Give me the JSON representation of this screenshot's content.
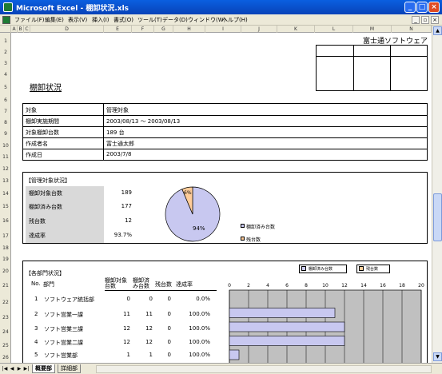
{
  "window": {
    "title": "Microsoft Excel - 棚卸状況.xls"
  },
  "menu": [
    "ファイル(F)",
    "編集(E)",
    "表示(V)",
    "挿入(I)",
    "書式(O)",
    "ツール(T)",
    "データ(D)",
    "ウィンドウ(W)",
    "ヘルプ(H)"
  ],
  "columns": [
    "A",
    "B",
    "C",
    "D",
    "E",
    "F",
    "G",
    "H",
    "I",
    "J",
    "K",
    "L",
    "M",
    "N"
  ],
  "rows": [
    "1",
    "2",
    "3",
    "4",
    "5",
    "6",
    "7",
    "8",
    "9",
    "10",
    "11",
    "12",
    "13",
    "14",
    "15",
    "16",
    "17",
    "18",
    "19",
    "20",
    "21",
    "22",
    "23",
    "24",
    "25",
    "26"
  ],
  "company": "富士通ソフトウェア",
  "heading": "棚卸状況",
  "info": [
    {
      "label": "対象",
      "value": "管理対象"
    },
    {
      "label": "棚卸実施期間",
      "value": "2003/08/13 〜 2003/08/13"
    },
    {
      "label": "対象棚卸台数",
      "value": "189 台"
    },
    {
      "label": "作成者名",
      "value": "富士通太郎"
    },
    {
      "label": "作成日",
      "value": "2003/7/8"
    }
  ],
  "managed": {
    "title": "【管理対象状況】",
    "rows": [
      {
        "label": "棚卸対象台数",
        "value": "189"
      },
      {
        "label": "棚卸済み台数",
        "value": "177"
      },
      {
        "label": "残台数",
        "value": "12"
      },
      {
        "label": "達成率",
        "value": "93.7%"
      }
    ],
    "pie": {
      "done_label": "94%",
      "remain_label": "6%",
      "legend": [
        "棚卸済み台数",
        "残台数"
      ]
    }
  },
  "dept": {
    "title": "【各部門状況】",
    "headers": [
      "No.",
      "部門",
      "棚卸対象台数",
      "棚卸済み台数",
      "残台数",
      "達成率"
    ],
    "rows": [
      {
        "no": "1",
        "name": "ソフトウェア統括部",
        "target": "0",
        "done": "0",
        "remain": "0",
        "rate": "0.0%"
      },
      {
        "no": "2",
        "name": "ソフト営業一課",
        "target": "11",
        "done": "11",
        "remain": "0",
        "rate": "100.0%"
      },
      {
        "no": "3",
        "name": "ソフト営業三課",
        "target": "12",
        "done": "12",
        "remain": "0",
        "rate": "100.0%"
      },
      {
        "no": "4",
        "name": "ソフト営業二課",
        "target": "12",
        "done": "12",
        "remain": "0",
        "rate": "100.0%"
      },
      {
        "no": "5",
        "name": "ソフト営業部",
        "target": "1",
        "done": "1",
        "remain": "0",
        "rate": "100.0%"
      }
    ]
  },
  "chart_data": [
    {
      "type": "pie",
      "values": [
        177,
        12
      ],
      "labels": [
        "棚卸済み台数",
        "残台数"
      ],
      "data_labels": [
        "94%",
        "6%"
      ],
      "colors": [
        "#c8c8f0",
        "#ffcc99"
      ]
    },
    {
      "type": "bar",
      "orientation": "horizontal",
      "categories": [
        "ソフトウェア統括部",
        "ソフト営業一課",
        "ソフト営業三課",
        "ソフト営業二課",
        "ソフト営業部"
      ],
      "series": [
        {
          "name": "棚卸済み台数",
          "values": [
            0,
            11,
            12,
            12,
            1
          ]
        },
        {
          "name": "残台数",
          "values": [
            0,
            0,
            0,
            0,
            0
          ]
        }
      ],
      "xticks": [
        "0",
        "2",
        "4",
        "6",
        "8",
        "10",
        "12",
        "14",
        "16",
        "18",
        "20"
      ],
      "xlim": [
        0,
        20
      ],
      "colors": [
        "#c8c8f0",
        "#ffcc99"
      ]
    }
  ],
  "tabs": [
    "概要部",
    "詳細部"
  ]
}
